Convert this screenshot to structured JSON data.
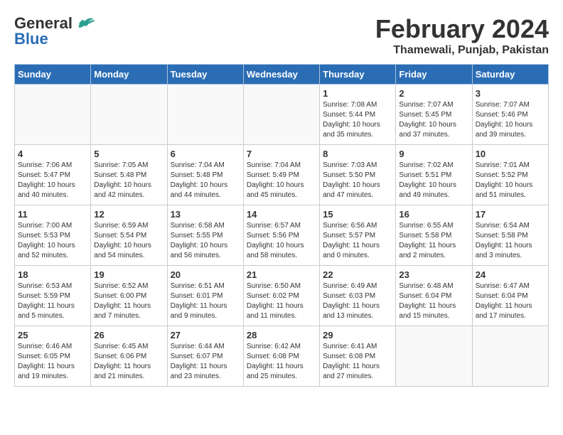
{
  "header": {
    "logo_general": "General",
    "logo_blue": "Blue",
    "month_title": "February 2024",
    "location": "Thamewali, Punjab, Pakistan"
  },
  "weekdays": [
    "Sunday",
    "Monday",
    "Tuesday",
    "Wednesday",
    "Thursday",
    "Friday",
    "Saturday"
  ],
  "weeks": [
    [
      {
        "day": "",
        "info": ""
      },
      {
        "day": "",
        "info": ""
      },
      {
        "day": "",
        "info": ""
      },
      {
        "day": "",
        "info": ""
      },
      {
        "day": "1",
        "info": "Sunrise: 7:08 AM\nSunset: 5:44 PM\nDaylight: 10 hours\nand 35 minutes."
      },
      {
        "day": "2",
        "info": "Sunrise: 7:07 AM\nSunset: 5:45 PM\nDaylight: 10 hours\nand 37 minutes."
      },
      {
        "day": "3",
        "info": "Sunrise: 7:07 AM\nSunset: 5:46 PM\nDaylight: 10 hours\nand 39 minutes."
      }
    ],
    [
      {
        "day": "4",
        "info": "Sunrise: 7:06 AM\nSunset: 5:47 PM\nDaylight: 10 hours\nand 40 minutes."
      },
      {
        "day": "5",
        "info": "Sunrise: 7:05 AM\nSunset: 5:48 PM\nDaylight: 10 hours\nand 42 minutes."
      },
      {
        "day": "6",
        "info": "Sunrise: 7:04 AM\nSunset: 5:48 PM\nDaylight: 10 hours\nand 44 minutes."
      },
      {
        "day": "7",
        "info": "Sunrise: 7:04 AM\nSunset: 5:49 PM\nDaylight: 10 hours\nand 45 minutes."
      },
      {
        "day": "8",
        "info": "Sunrise: 7:03 AM\nSunset: 5:50 PM\nDaylight: 10 hours\nand 47 minutes."
      },
      {
        "day": "9",
        "info": "Sunrise: 7:02 AM\nSunset: 5:51 PM\nDaylight: 10 hours\nand 49 minutes."
      },
      {
        "day": "10",
        "info": "Sunrise: 7:01 AM\nSunset: 5:52 PM\nDaylight: 10 hours\nand 51 minutes."
      }
    ],
    [
      {
        "day": "11",
        "info": "Sunrise: 7:00 AM\nSunset: 5:53 PM\nDaylight: 10 hours\nand 52 minutes."
      },
      {
        "day": "12",
        "info": "Sunrise: 6:59 AM\nSunset: 5:54 PM\nDaylight: 10 hours\nand 54 minutes."
      },
      {
        "day": "13",
        "info": "Sunrise: 6:58 AM\nSunset: 5:55 PM\nDaylight: 10 hours\nand 56 minutes."
      },
      {
        "day": "14",
        "info": "Sunrise: 6:57 AM\nSunset: 5:56 PM\nDaylight: 10 hours\nand 58 minutes."
      },
      {
        "day": "15",
        "info": "Sunrise: 6:56 AM\nSunset: 5:57 PM\nDaylight: 11 hours\nand 0 minutes."
      },
      {
        "day": "16",
        "info": "Sunrise: 6:55 AM\nSunset: 5:58 PM\nDaylight: 11 hours\nand 2 minutes."
      },
      {
        "day": "17",
        "info": "Sunrise: 6:54 AM\nSunset: 5:58 PM\nDaylight: 11 hours\nand 3 minutes."
      }
    ],
    [
      {
        "day": "18",
        "info": "Sunrise: 6:53 AM\nSunset: 5:59 PM\nDaylight: 11 hours\nand 5 minutes."
      },
      {
        "day": "19",
        "info": "Sunrise: 6:52 AM\nSunset: 6:00 PM\nDaylight: 11 hours\nand 7 minutes."
      },
      {
        "day": "20",
        "info": "Sunrise: 6:51 AM\nSunset: 6:01 PM\nDaylight: 11 hours\nand 9 minutes."
      },
      {
        "day": "21",
        "info": "Sunrise: 6:50 AM\nSunset: 6:02 PM\nDaylight: 11 hours\nand 11 minutes."
      },
      {
        "day": "22",
        "info": "Sunrise: 6:49 AM\nSunset: 6:03 PM\nDaylight: 11 hours\nand 13 minutes."
      },
      {
        "day": "23",
        "info": "Sunrise: 6:48 AM\nSunset: 6:04 PM\nDaylight: 11 hours\nand 15 minutes."
      },
      {
        "day": "24",
        "info": "Sunrise: 6:47 AM\nSunset: 6:04 PM\nDaylight: 11 hours\nand 17 minutes."
      }
    ],
    [
      {
        "day": "25",
        "info": "Sunrise: 6:46 AM\nSunset: 6:05 PM\nDaylight: 11 hours\nand 19 minutes."
      },
      {
        "day": "26",
        "info": "Sunrise: 6:45 AM\nSunset: 6:06 PM\nDaylight: 11 hours\nand 21 minutes."
      },
      {
        "day": "27",
        "info": "Sunrise: 6:44 AM\nSunset: 6:07 PM\nDaylight: 11 hours\nand 23 minutes."
      },
      {
        "day": "28",
        "info": "Sunrise: 6:42 AM\nSunset: 6:08 PM\nDaylight: 11 hours\nand 25 minutes."
      },
      {
        "day": "29",
        "info": "Sunrise: 6:41 AM\nSunset: 6:08 PM\nDaylight: 11 hours\nand 27 minutes."
      },
      {
        "day": "",
        "info": ""
      },
      {
        "day": "",
        "info": ""
      }
    ]
  ]
}
